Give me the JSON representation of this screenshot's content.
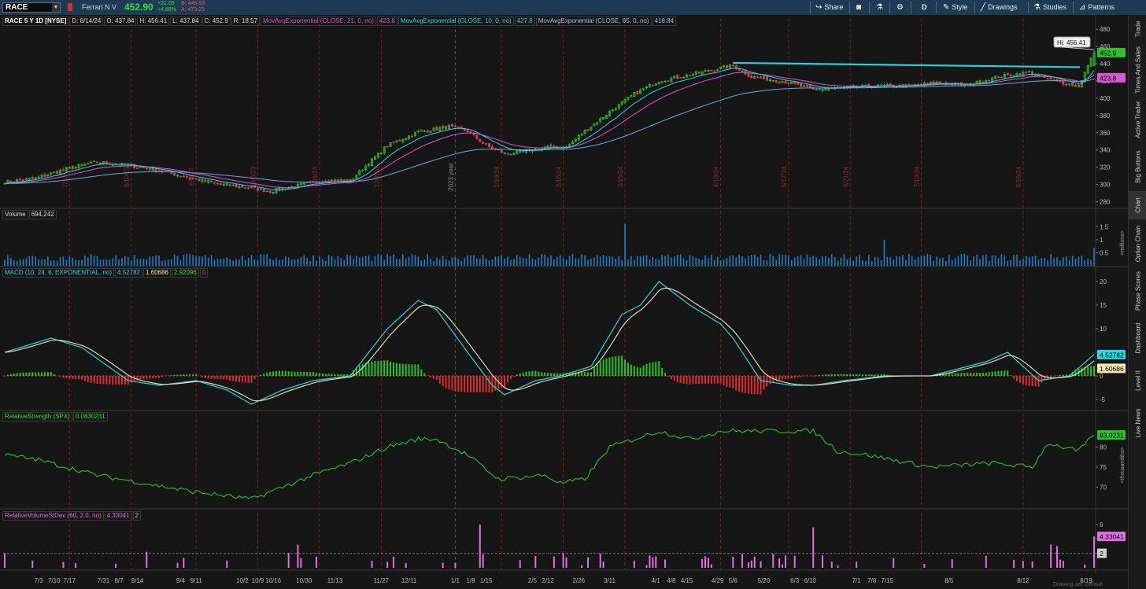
{
  "toolbar": {
    "symbol": "RACE",
    "company": "Ferrari N V",
    "last": "452.90",
    "change": "+21.09",
    "change_pct": "+4.88%",
    "bid": "B: 448.63",
    "ask": "A: 473.25",
    "buttons": {
      "share": "Share",
      "period": "D",
      "style": "Style",
      "drawings": "Drawings",
      "studies": "Studies",
      "patterns": "Patterns"
    }
  },
  "sidebar": {
    "tabs": [
      "Trade",
      "Times And Sales",
      "Active Trader",
      "Big Buttons",
      "Chart",
      "Option Chain",
      "Phase Scores",
      "Dashboard",
      "Level II",
      "Live News"
    ]
  },
  "price_pane": {
    "header": {
      "title": "RACE 5 Y 1D [NYSE]",
      "date": "D: 8/14/24",
      "open": "O: 437.84",
      "high": "H: 456.41",
      "low": "L: 437.84",
      "close": "C: 452.9",
      "range": "R: 18.57",
      "ema21_name": "MovAvgExponential (CLOSE, 21, 0, no)",
      "ema21_value": "423.8",
      "ema10_name": "MovAvgExponential (CLOSE, 10, 0, no)",
      "ema10_value": "427.8",
      "ema65_name": "MovAvgExponential (CLOSE, 65, 0, no)",
      "ema65_value": "418.84"
    },
    "hi_bubble": "Hi: 456.41",
    "last_tag": "452.9",
    "ema_tag": "423.8",
    "y_ticks": [
      "480",
      "460",
      "440",
      "420",
      "400",
      "380",
      "360",
      "340",
      "320",
      "300",
      "280"
    ],
    "vertical_labels": [
      "7/13/23",
      "8/10/23",
      "9/8/23",
      "10/6/23",
      "11/3/23",
      "12/1/23",
      "2023 year",
      "1/19/24",
      "2/16/24",
      "3/15/24",
      "4/19/24",
      "5/17/24",
      "6/21/24",
      "7/19/24",
      "8/16/24"
    ],
    "resistance_level": 436,
    "colors": {
      "up": "#27c427",
      "down": "#e04040",
      "ema10": "#29d7e6",
      "ema21": "#d658d6",
      "ema65": "#6fa8dc",
      "resistance": "#22d3e0"
    }
  },
  "volume_pane": {
    "label": "Volume",
    "value": "694,242",
    "y_ticks": [
      "1.5",
      "1",
      "0.5"
    ],
    "unit": "<millions>"
  },
  "macd_pane": {
    "label": "MACD (10, 24, 6, EXPONENTIAL, no)",
    "value": "4.52782",
    "avg": "1.60686",
    "diff": "2.92096",
    "zero": "0",
    "y_ticks": [
      "20",
      "15",
      "10",
      "5",
      "0",
      "-5"
    ],
    "tag_value": "4.52782",
    "tag_avg": "1.60686"
  },
  "rs_pane": {
    "label": "RelativeStrength (SPX)",
    "value": "0.0830231",
    "y_ticks": [
      "80",
      "75",
      "70"
    ],
    "tag": "83.0231",
    "unit": "<thousandths>"
  },
  "rvsd_pane": {
    "label": "RelativeVolumeStDev (60, 2.0, no)",
    "value": "4.33041",
    "threshold": "2",
    "y_ticks": [
      "6",
      "4",
      "2"
    ],
    "tag": "4.33041",
    "tag2": "2"
  },
  "x_axis": {
    "labels": [
      "7/3",
      "7/10",
      "7/17",
      "7/31",
      "8/7",
      "8/14",
      "9/4",
      "9/11",
      "10/2",
      "10/9",
      "10/16",
      "10/30",
      "11/13",
      "11/27",
      "12/11",
      "1/1",
      "1/8",
      "1/15",
      "2/5",
      "2/12",
      "2/26",
      "3/11",
      "4/1",
      "4/8",
      "4/15",
      "4/29",
      "5/6",
      "5/20",
      "6/3",
      "6/10",
      "7/1",
      "7/8",
      "7/15",
      "8/5",
      "8/12",
      "8/19"
    ]
  },
  "footer": {
    "drawing_set": "Drawing set: Default"
  },
  "chart_data": {
    "type": "candlestick",
    "title": "RACE 5 Y 1D [NYSE]",
    "price_path": [
      [
        0,
        303
      ],
      [
        10,
        307
      ],
      [
        20,
        318
      ],
      [
        30,
        326
      ],
      [
        40,
        322
      ],
      [
        50,
        316
      ],
      [
        62,
        306
      ],
      [
        70,
        300
      ],
      [
        78,
        297
      ],
      [
        86,
        292
      ],
      [
        94,
        298
      ],
      [
        104,
        305
      ],
      [
        112,
        304
      ],
      [
        118,
        325
      ],
      [
        124,
        345
      ],
      [
        134,
        361
      ],
      [
        144,
        367
      ],
      [
        150,
        362
      ],
      [
        156,
        345
      ],
      [
        162,
        336
      ],
      [
        168,
        337
      ],
      [
        176,
        344
      ],
      [
        182,
        343
      ],
      [
        188,
        362
      ],
      [
        196,
        384
      ],
      [
        204,
        405
      ],
      [
        212,
        420
      ],
      [
        222,
        427
      ],
      [
        232,
        435
      ],
      [
        236,
        438
      ],
      [
        242,
        425
      ],
      [
        252,
        420
      ],
      [
        262,
        410
      ],
      [
        272,
        412
      ],
      [
        282,
        414
      ],
      [
        292,
        414
      ],
      [
        302,
        418
      ],
      [
        312,
        415
      ],
      [
        322,
        425
      ],
      [
        332,
        430
      ],
      [
        340,
        420
      ],
      [
        348,
        414
      ],
      [
        353,
        452.9
      ]
    ],
    "last_price": 452.9,
    "day_high": 456.41,
    "ema10_last": 427.8,
    "ema21_last": 423.8,
    "ema65_last": 418.84,
    "resistance": 436,
    "volume_spikes": [
      [
        201,
        1.6
      ],
      [
        285,
        1.0
      ],
      [
        353,
        0.69
      ]
    ],
    "macd_path": [
      [
        0,
        5
      ],
      [
        15,
        8
      ],
      [
        25,
        6
      ],
      [
        40,
        -1
      ],
      [
        50,
        -2
      ],
      [
        62,
        -1
      ],
      [
        72,
        -3
      ],
      [
        80,
        -6
      ],
      [
        90,
        -3
      ],
      [
        100,
        -1
      ],
      [
        112,
        0
      ],
      [
        124,
        10
      ],
      [
        134,
        16
      ],
      [
        140,
        14
      ],
      [
        150,
        5
      ],
      [
        158,
        -2
      ],
      [
        162,
        -4
      ],
      [
        172,
        -1
      ],
      [
        180,
        0
      ],
      [
        190,
        2
      ],
      [
        200,
        13
      ],
      [
        206,
        15
      ],
      [
        212,
        20
      ],
      [
        222,
        15
      ],
      [
        232,
        11
      ],
      [
        236,
        8
      ],
      [
        245,
        -1
      ],
      [
        255,
        -2
      ],
      [
        262,
        -2
      ],
      [
        272,
        -1
      ],
      [
        285,
        0
      ],
      [
        300,
        0
      ],
      [
        318,
        3
      ],
      [
        325,
        5
      ],
      [
        335,
        -1
      ],
      [
        345,
        0
      ],
      [
        353,
        4.53
      ]
    ],
    "rs_path": [
      [
        0,
        78
      ],
      [
        10,
        77
      ],
      [
        30,
        73
      ],
      [
        60,
        69
      ],
      [
        80,
        67
      ],
      [
        100,
        73
      ],
      [
        112,
        76
      ],
      [
        124,
        80
      ],
      [
        134,
        82
      ],
      [
        140,
        82
      ],
      [
        150,
        78
      ],
      [
        160,
        72
      ],
      [
        175,
        73
      ],
      [
        180,
        71
      ],
      [
        188,
        72
      ],
      [
        196,
        80
      ],
      [
        204,
        82
      ],
      [
        212,
        84
      ],
      [
        222,
        82
      ],
      [
        232,
        84
      ],
      [
        240,
        84
      ],
      [
        262,
        84
      ],
      [
        270,
        79
      ],
      [
        280,
        78
      ],
      [
        300,
        75
      ],
      [
        320,
        76
      ],
      [
        333,
        75
      ],
      [
        338,
        81
      ],
      [
        348,
        79
      ],
      [
        353,
        83.02
      ]
    ],
    "rvsd_spikes": [
      [
        46,
        2.2
      ],
      [
        95,
        3.2
      ],
      [
        154,
        6.0
      ],
      [
        262,
        5.6
      ],
      [
        339,
        3.2
      ],
      [
        341,
        3.0
      ],
      [
        353,
        4.33
      ]
    ]
  }
}
